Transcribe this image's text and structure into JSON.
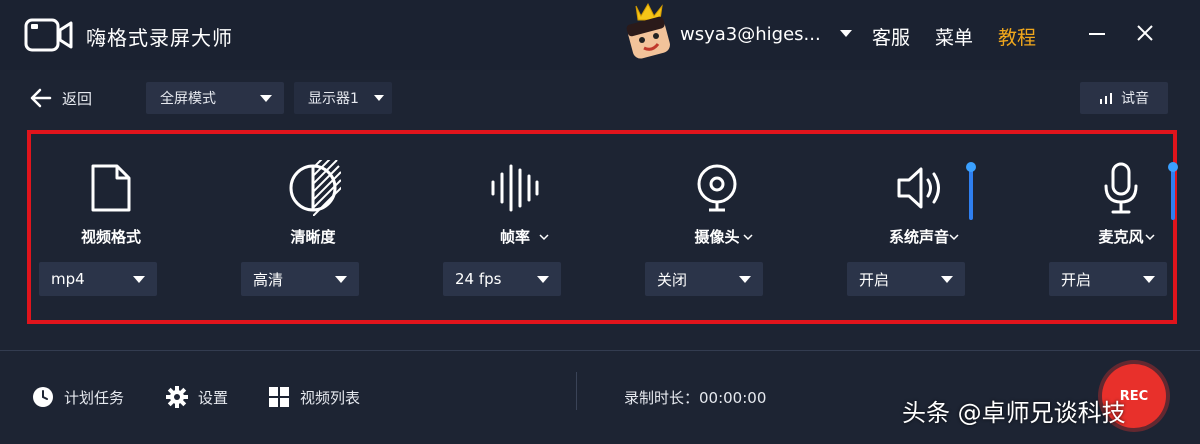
{
  "app": {
    "title": "嗨格式录屏大师",
    "username": "wsya3@higes...",
    "links": {
      "support": "客服",
      "menu": "菜单",
      "tutorial": "教程"
    },
    "accent_color": "#f0a71c"
  },
  "toolbar": {
    "back_label": "返回",
    "mode_select": "全屏模式",
    "monitor_select": "显示器1",
    "audio_test_label": "试音"
  },
  "settings": {
    "video_format": {
      "label": "视频格式",
      "value": "mp4",
      "icon": "file-icon"
    },
    "quality": {
      "label": "清晰度",
      "value": "高清",
      "icon": "half-circle-icon"
    },
    "frame_rate": {
      "label": "帧率",
      "value": "24 fps",
      "icon": "waveform-icon"
    },
    "camera": {
      "label": "摄像头",
      "value": "关闭",
      "icon": "webcam-icon"
    },
    "system_sound": {
      "label": "系统声音",
      "value": "开启",
      "icon": "speaker-icon"
    },
    "microphone": {
      "label": "麦克风",
      "value": "开启",
      "icon": "microphone-icon"
    }
  },
  "bottom": {
    "schedule_label": "计划任务",
    "settings_label": "设置",
    "video_list_label": "视频列表",
    "duration_text": "录制时长：00:00:00",
    "rec_label": "REC"
  },
  "watermark": "头条 @卓师兄谈科技",
  "highlight_color": "#e0141c"
}
